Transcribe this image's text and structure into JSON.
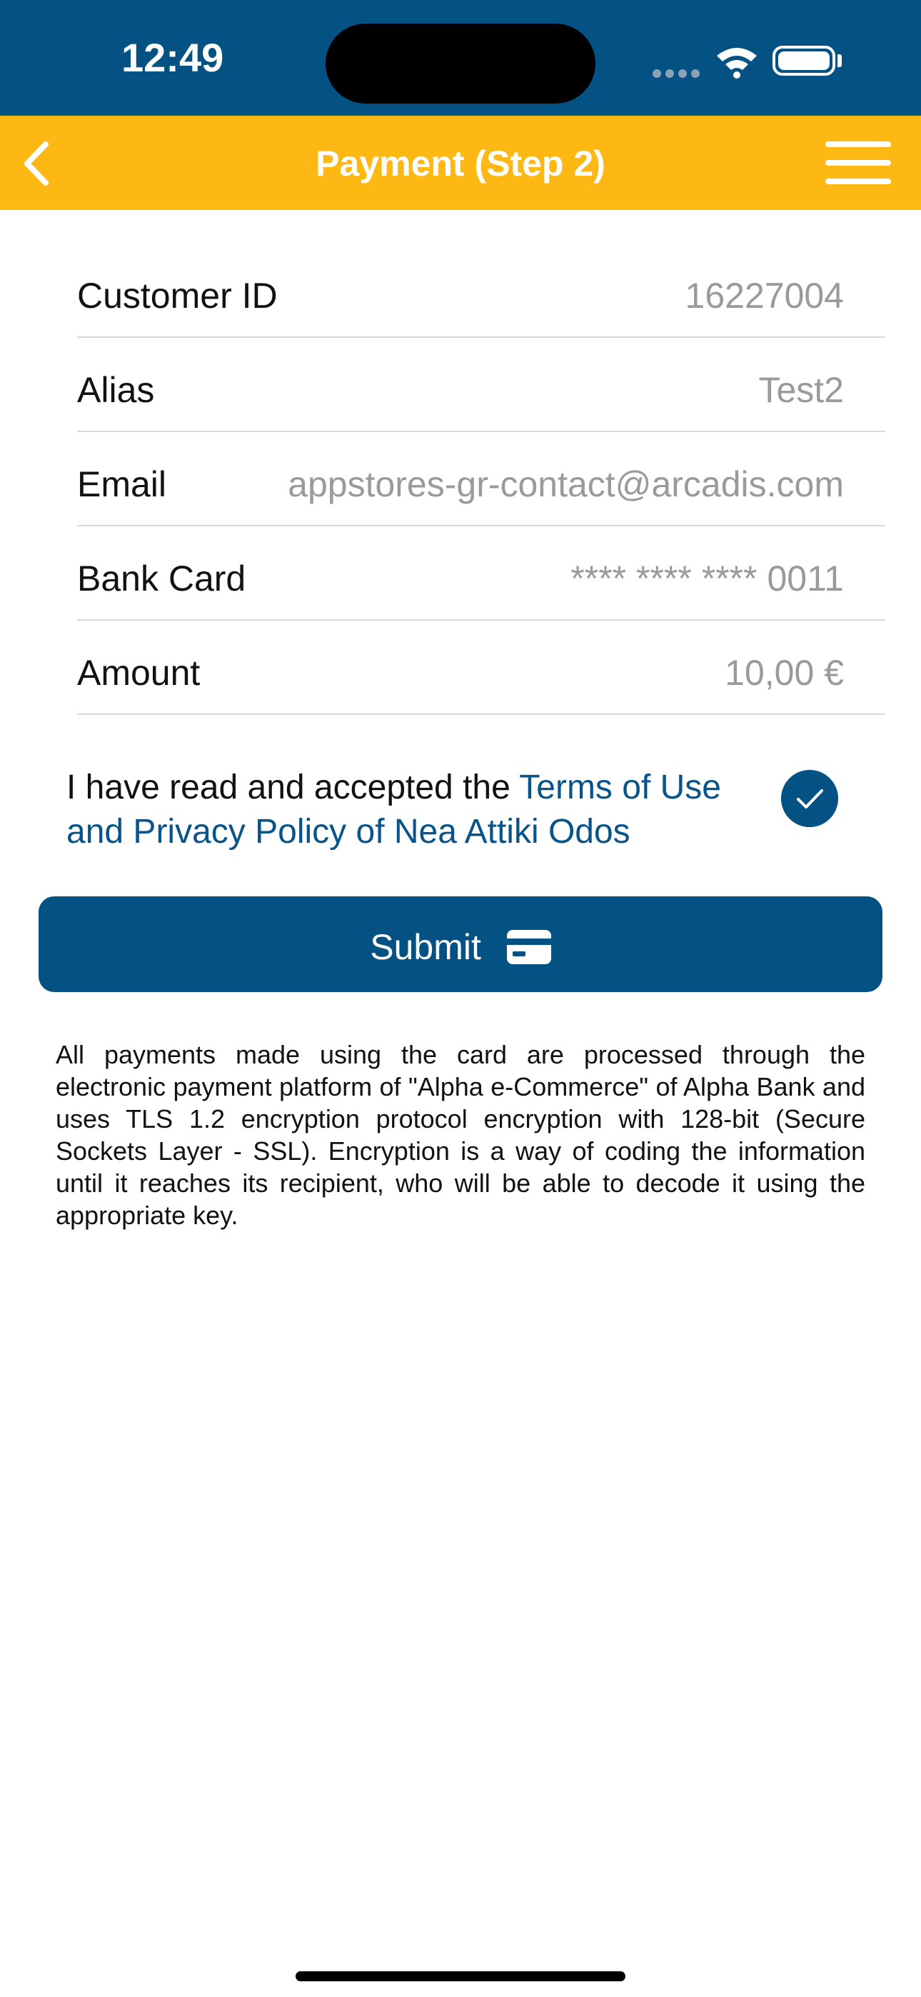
{
  "status_bar": {
    "time": "12:49"
  },
  "header": {
    "title": "Payment (Step 2)"
  },
  "details": [
    {
      "label": "Customer ID",
      "value": "16227004"
    },
    {
      "label": "Alias",
      "value": "Test2"
    },
    {
      "label": "Email",
      "value": "appstores-gr-contact@arcadis.com"
    },
    {
      "label": "Bank Card",
      "value": "**** **** **** 0011"
    },
    {
      "label": "Amount",
      "value": "10,00 €"
    }
  ],
  "terms": {
    "prefix": "I have read and accepted the ",
    "link": "Terms of Use and Privacy Policy of Nea Attiki Odos",
    "checked": true
  },
  "submit": {
    "label": "Submit"
  },
  "notice": "All payments made using the card are processed through the electronic payment platform of \"Alpha e-Commerce\" of Alpha Bank and uses TLS 1.2 encryption protocol encryption with 128-bit (Secure Sockets Layer - SSL). Encryption is a way of coding the information until it reaches its recipient, who will be able to decode it using the appropriate key.",
  "colors": {
    "primary": "#045183",
    "accent": "#fdb813",
    "link": "#07548a"
  }
}
